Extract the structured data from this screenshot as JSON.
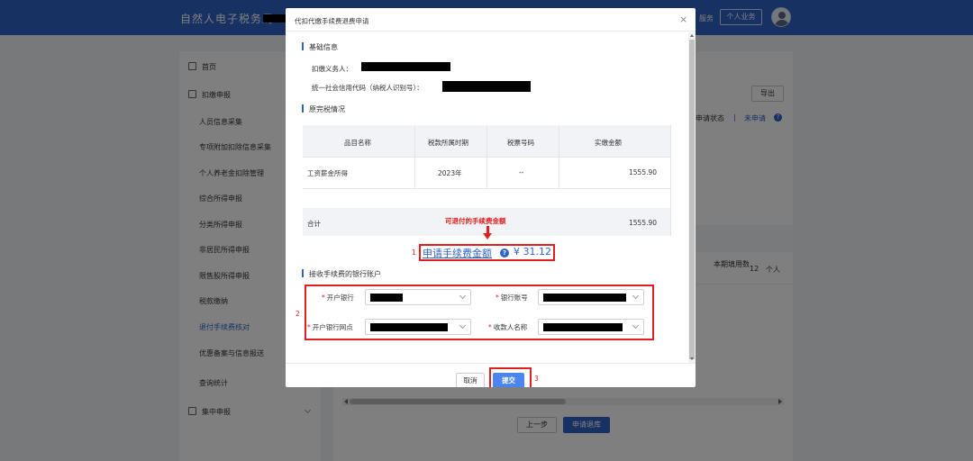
{
  "header": {
    "brand": "自然人电子税务局",
    "link_service": "服务",
    "personal_button": "个人业务"
  },
  "sidebar": {
    "items": [
      {
        "label": "首页"
      },
      {
        "label": "扣缴申报"
      },
      {
        "label": "人员信息采集"
      },
      {
        "label": "专项附加扣除信息采集"
      },
      {
        "label": "个人养老金扣除管理"
      },
      {
        "label": "综合所得申报"
      },
      {
        "label": "分类所得申报"
      },
      {
        "label": "非居民所得申报"
      },
      {
        "label": "限售股所得申报"
      },
      {
        "label": "税款缴纳"
      },
      {
        "label": "退付手续费核对"
      },
      {
        "label": "优惠备案与信息报送"
      },
      {
        "label": "查询统计"
      },
      {
        "label": "集中申报"
      }
    ]
  },
  "background": {
    "export_button": "导出",
    "status_label": "申请状态",
    "separator": "|",
    "status_value": "未申请",
    "col_period_count": "本期填用数",
    "row_count_value": "12",
    "row_person_prefix": "个人",
    "prev_button": "上一步",
    "refund_button": "申请退库"
  },
  "modal": {
    "title": "代扣代缴手续费退费申请",
    "close": "×",
    "basic_info_title": "基础信息",
    "withholder_label": "扣缴义务人：",
    "credit_code_label": "统一社会信用代码（纳税人识别号）：",
    "tax_section_title": "原完税情况",
    "table": {
      "headers": [
        "品目名称",
        "税款所属时期",
        "税票号码",
        "实缴金额"
      ],
      "rows": [
        {
          "item": "工资薪金所得",
          "period": "2023年",
          "ticket": "--",
          "amount": "1555.90"
        }
      ],
      "total_label": "合计",
      "total_amount": "1555.90"
    },
    "annotation": "可退付的手续费金额",
    "marker_1": "1",
    "marker_2": "2",
    "marker_3": "3",
    "apply_amount_label": "申请手续费金额",
    "help_icon_text": "?",
    "apply_amount_value": "¥ 31.12",
    "bank_section_title": "接收手续费的银行账户",
    "fields": {
      "bank_label": "开户银行",
      "account_label": "银行账号",
      "branch_label": "开户银行网点",
      "payee_label": "收款人名称",
      "required_mark": "*"
    },
    "cancel_button": "取消",
    "submit_button": "提交"
  },
  "colors": {
    "brand_blue": "#2e63c7",
    "annotation_red": "#e02020",
    "submit_blue": "#4a85f0"
  }
}
